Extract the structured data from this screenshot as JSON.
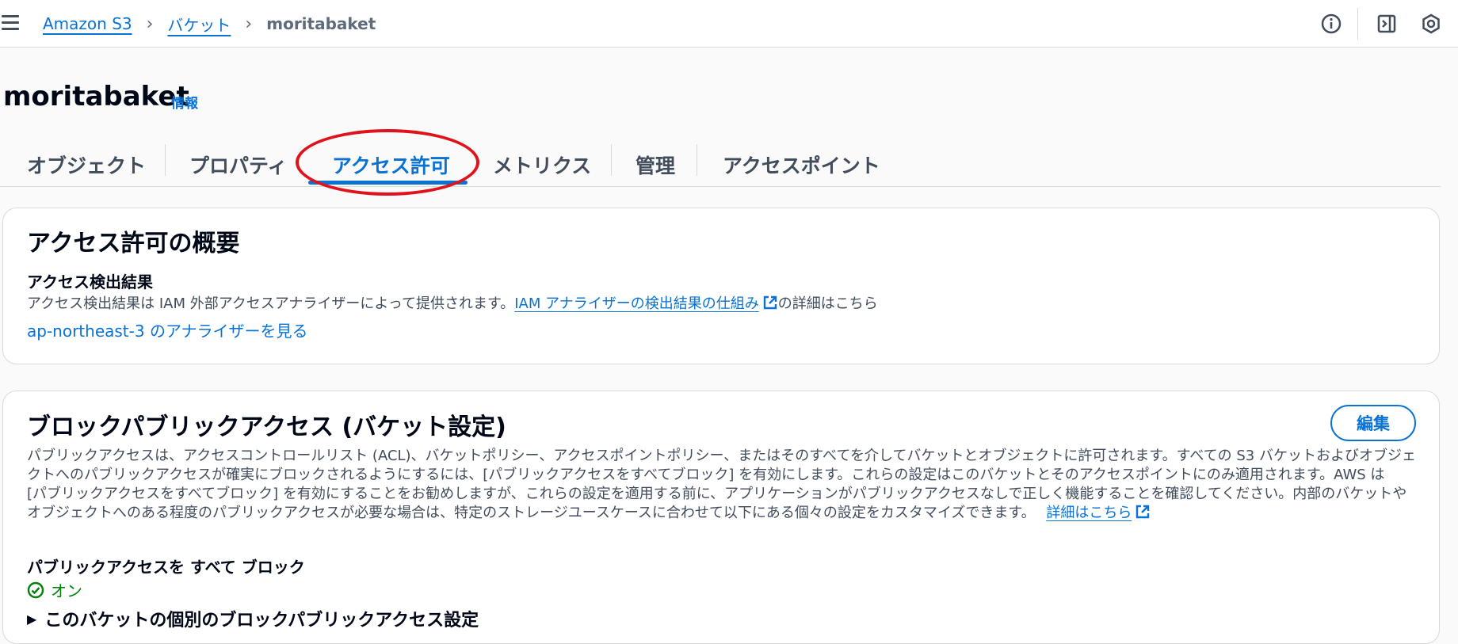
{
  "breadcrumbs": [
    {
      "label": "Amazon S3"
    },
    {
      "label": "バケット"
    },
    {
      "label": "moritabaket"
    }
  ],
  "header_icons": [
    "info-icon",
    "panel-toggle-icon",
    "settings-icon"
  ],
  "page": {
    "title": "moritabaket",
    "info_label": "情報"
  },
  "tabs": [
    {
      "label": "オブジェクト"
    },
    {
      "label": "プロパティ"
    },
    {
      "label": "アクセス許可",
      "active": true
    },
    {
      "label": "メトリクス"
    },
    {
      "label": "管理"
    },
    {
      "label": "アクセスポイント"
    }
  ],
  "overview": {
    "title": "アクセス許可の概要",
    "findings_heading": "アクセス検出結果",
    "findings_text": "アクセス検出結果は IAM 外部アクセスアナライザーによって提供されます。",
    "findings_link": "IAM アナライザーの検出結果の仕組み",
    "findings_suffix": "の詳細はこちら",
    "analyzer_link": "ap-northeast-3 のアナライザーを見る"
  },
  "block_public_access": {
    "title": "ブロックパブリックアクセス (バケット設定)",
    "edit_button": "編集",
    "line1": "パブリックアクセスは、アクセスコントロールリスト (ACL)、バケットポリシー、アクセスポイントポリシー、またはそのすべてを介してバケットとオブジェクトに許可されます。すべての S3 バケットおよびオブジェ",
    "line2": "クトへのパブリックアクセスが確実にブロックされるようにするには、[パブリックアクセスをすべてブロック] を有効にします。これらの設定はこのバケットとそのアクセスポイントにのみ適用されます。AWS は",
    "line3": "[パブリックアクセスをすべてブロック] を有効にすることをお勧めしますが、これらの設定を適用する前に、アプリケーションがパブリックアクセスなしで正しく機能することを確認してください。内部のバケットや",
    "line4": "オブジェクトへのある程度のパブリックアクセスが必要な場合は、特定のストレージユースケースに合わせて以下にある個々の設定をカスタマイズできます。",
    "learn_more_link": "詳細はこちら",
    "block_all_heading": "パブリックアクセスを すべて ブロック",
    "block_all_status": "オン",
    "individual_settings_label": "このバケットの個別のブロックパブリックアクセス設定"
  },
  "colors": {
    "accent": "#0972d3",
    "success": "#037f0c",
    "annotation": "#e0121b"
  }
}
